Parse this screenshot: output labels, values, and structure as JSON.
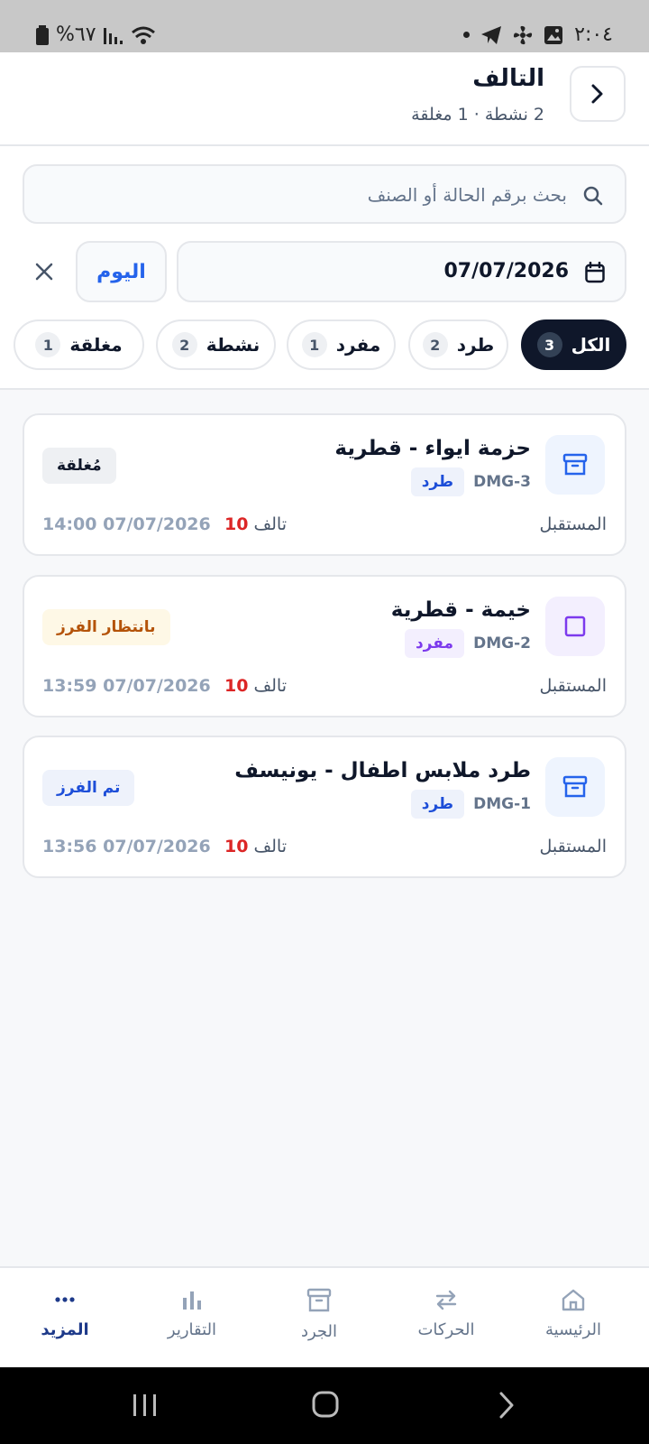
{
  "status_bar": {
    "time": "٢:٠٤",
    "battery": "%٦٧"
  },
  "header": {
    "title": "التالف",
    "subtitle": "2 نشطة · 1 مغلقة"
  },
  "search": {
    "placeholder": "بحث برقم الحالة أو الصنف"
  },
  "date_filter": {
    "value": "07/07/2026",
    "today_label": "اليوم"
  },
  "chips": [
    {
      "label": "الكل",
      "count": "3",
      "active": true
    },
    {
      "label": "طرد",
      "count": "2",
      "active": false
    },
    {
      "label": "مفرد",
      "count": "1",
      "active": false
    },
    {
      "label": "نشطة",
      "count": "2",
      "active": false
    },
    {
      "label": "مغلقة",
      "count": "1",
      "active": false
    }
  ],
  "cards": [
    {
      "title": "حزمة ايواء - قطرية",
      "code": "DMG-3",
      "tag": "طرد",
      "status": "مُغلقة",
      "location": "المستقبل",
      "damaged_label": "تالف",
      "damaged_count": "10",
      "datetime": "14:00 07/07/2026"
    },
    {
      "title": "خيمة - قطرية",
      "code": "DMG-2",
      "tag": "مفرد",
      "status": "بانتظار الفرز",
      "location": "المستقبل",
      "damaged_label": "تالف",
      "damaged_count": "10",
      "datetime": "13:59 07/07/2026"
    },
    {
      "title": "طرد ملابس اطفال - يونيسف",
      "code": "DMG-1",
      "tag": "طرد",
      "status": "تم الفرز",
      "location": "المستقبل",
      "damaged_label": "تالف",
      "damaged_count": "10",
      "datetime": "13:56 07/07/2026"
    }
  ],
  "bottom_nav": [
    {
      "label": "الرئيسية",
      "icon": "home-icon"
    },
    {
      "label": "الحركات",
      "icon": "transfer-icon"
    },
    {
      "label": "الجرد",
      "icon": "archive-icon"
    },
    {
      "label": "التقارير",
      "icon": "bar-chart-icon"
    },
    {
      "label": "المزيد",
      "icon": "more-icon",
      "active": true
    }
  ],
  "colors": {
    "accent": "#2563eb",
    "dark": "#0f172a",
    "danger": "#dc2626",
    "status_closed_bg": "#eef0f3",
    "status_pending_bg": "#fef8e6",
    "status_pending_fg": "#b45309",
    "status_sorted_bg": "#eef2fb",
    "status_sorted_fg": "#1d4ed8"
  }
}
